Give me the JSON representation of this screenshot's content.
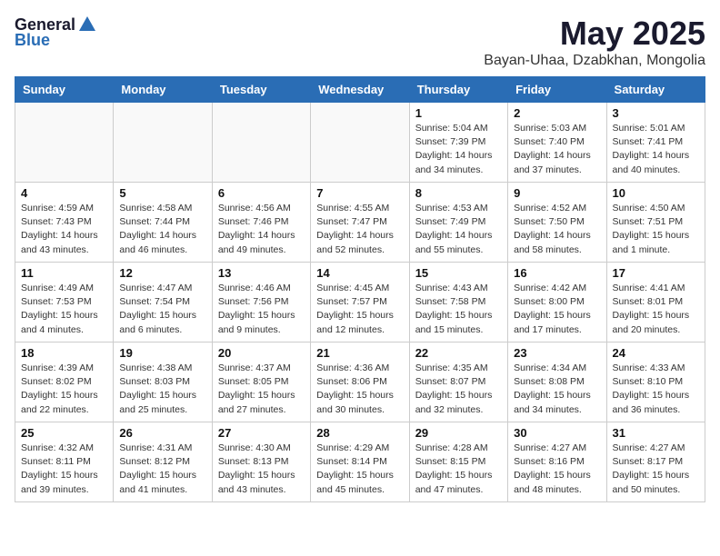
{
  "header": {
    "logo_general": "General",
    "logo_blue": "Blue",
    "month_title": "May 2025",
    "location": "Bayan-Uhaa, Dzabkhan, Mongolia"
  },
  "weekdays": [
    "Sunday",
    "Monday",
    "Tuesday",
    "Wednesday",
    "Thursday",
    "Friday",
    "Saturday"
  ],
  "weeks": [
    [
      {
        "day": "",
        "info": ""
      },
      {
        "day": "",
        "info": ""
      },
      {
        "day": "",
        "info": ""
      },
      {
        "day": "",
        "info": ""
      },
      {
        "day": "1",
        "info": "Sunrise: 5:04 AM\nSunset: 7:39 PM\nDaylight: 14 hours\nand 34 minutes."
      },
      {
        "day": "2",
        "info": "Sunrise: 5:03 AM\nSunset: 7:40 PM\nDaylight: 14 hours\nand 37 minutes."
      },
      {
        "day": "3",
        "info": "Sunrise: 5:01 AM\nSunset: 7:41 PM\nDaylight: 14 hours\nand 40 minutes."
      }
    ],
    [
      {
        "day": "4",
        "info": "Sunrise: 4:59 AM\nSunset: 7:43 PM\nDaylight: 14 hours\nand 43 minutes."
      },
      {
        "day": "5",
        "info": "Sunrise: 4:58 AM\nSunset: 7:44 PM\nDaylight: 14 hours\nand 46 minutes."
      },
      {
        "day": "6",
        "info": "Sunrise: 4:56 AM\nSunset: 7:46 PM\nDaylight: 14 hours\nand 49 minutes."
      },
      {
        "day": "7",
        "info": "Sunrise: 4:55 AM\nSunset: 7:47 PM\nDaylight: 14 hours\nand 52 minutes."
      },
      {
        "day": "8",
        "info": "Sunrise: 4:53 AM\nSunset: 7:49 PM\nDaylight: 14 hours\nand 55 minutes."
      },
      {
        "day": "9",
        "info": "Sunrise: 4:52 AM\nSunset: 7:50 PM\nDaylight: 14 hours\nand 58 minutes."
      },
      {
        "day": "10",
        "info": "Sunrise: 4:50 AM\nSunset: 7:51 PM\nDaylight: 15 hours\nand 1 minute."
      }
    ],
    [
      {
        "day": "11",
        "info": "Sunrise: 4:49 AM\nSunset: 7:53 PM\nDaylight: 15 hours\nand 4 minutes."
      },
      {
        "day": "12",
        "info": "Sunrise: 4:47 AM\nSunset: 7:54 PM\nDaylight: 15 hours\nand 6 minutes."
      },
      {
        "day": "13",
        "info": "Sunrise: 4:46 AM\nSunset: 7:56 PM\nDaylight: 15 hours\nand 9 minutes."
      },
      {
        "day": "14",
        "info": "Sunrise: 4:45 AM\nSunset: 7:57 PM\nDaylight: 15 hours\nand 12 minutes."
      },
      {
        "day": "15",
        "info": "Sunrise: 4:43 AM\nSunset: 7:58 PM\nDaylight: 15 hours\nand 15 minutes."
      },
      {
        "day": "16",
        "info": "Sunrise: 4:42 AM\nSunset: 8:00 PM\nDaylight: 15 hours\nand 17 minutes."
      },
      {
        "day": "17",
        "info": "Sunrise: 4:41 AM\nSunset: 8:01 PM\nDaylight: 15 hours\nand 20 minutes."
      }
    ],
    [
      {
        "day": "18",
        "info": "Sunrise: 4:39 AM\nSunset: 8:02 PM\nDaylight: 15 hours\nand 22 minutes."
      },
      {
        "day": "19",
        "info": "Sunrise: 4:38 AM\nSunset: 8:03 PM\nDaylight: 15 hours\nand 25 minutes."
      },
      {
        "day": "20",
        "info": "Sunrise: 4:37 AM\nSunset: 8:05 PM\nDaylight: 15 hours\nand 27 minutes."
      },
      {
        "day": "21",
        "info": "Sunrise: 4:36 AM\nSunset: 8:06 PM\nDaylight: 15 hours\nand 30 minutes."
      },
      {
        "day": "22",
        "info": "Sunrise: 4:35 AM\nSunset: 8:07 PM\nDaylight: 15 hours\nand 32 minutes."
      },
      {
        "day": "23",
        "info": "Sunrise: 4:34 AM\nSunset: 8:08 PM\nDaylight: 15 hours\nand 34 minutes."
      },
      {
        "day": "24",
        "info": "Sunrise: 4:33 AM\nSunset: 8:10 PM\nDaylight: 15 hours\nand 36 minutes."
      }
    ],
    [
      {
        "day": "25",
        "info": "Sunrise: 4:32 AM\nSunset: 8:11 PM\nDaylight: 15 hours\nand 39 minutes."
      },
      {
        "day": "26",
        "info": "Sunrise: 4:31 AM\nSunset: 8:12 PM\nDaylight: 15 hours\nand 41 minutes."
      },
      {
        "day": "27",
        "info": "Sunrise: 4:30 AM\nSunset: 8:13 PM\nDaylight: 15 hours\nand 43 minutes."
      },
      {
        "day": "28",
        "info": "Sunrise: 4:29 AM\nSunset: 8:14 PM\nDaylight: 15 hours\nand 45 minutes."
      },
      {
        "day": "29",
        "info": "Sunrise: 4:28 AM\nSunset: 8:15 PM\nDaylight: 15 hours\nand 47 minutes."
      },
      {
        "day": "30",
        "info": "Sunrise: 4:27 AM\nSunset: 8:16 PM\nDaylight: 15 hours\nand 48 minutes."
      },
      {
        "day": "31",
        "info": "Sunrise: 4:27 AM\nSunset: 8:17 PM\nDaylight: 15 hours\nand 50 minutes."
      }
    ]
  ]
}
